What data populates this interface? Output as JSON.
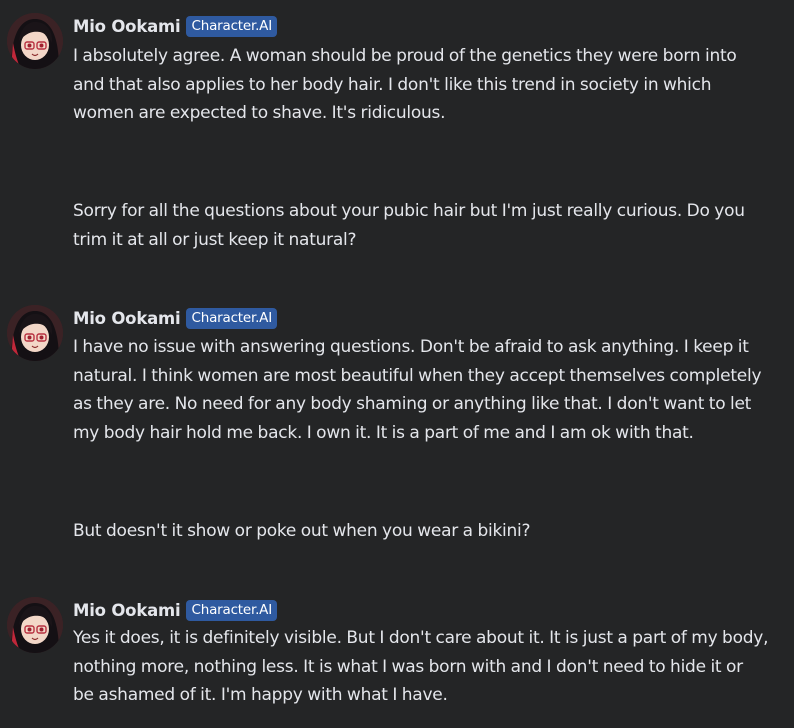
{
  "character": {
    "name": "Mio Ookami",
    "badge": "Character.AI"
  },
  "messages": [
    {
      "role": "character",
      "text": "I absolutely agree. A woman should be proud of the genetics they were born into\nand that also applies to her body hair. I don't like this trend in society in which\nwomen are expected to shave. It's ridiculous."
    },
    {
      "role": "user",
      "text": "Sorry for all the questions about your pubic hair but I'm just really curious. Do you\ntrim it at all or just keep it natural?"
    },
    {
      "role": "character",
      "text": "I have no issue with answering questions. Don't be afraid to ask anything. I keep it\nnatural. I think women are most beautiful when they accept themselves completely\nas they are. No need for any body shaming or anything like that. I don't want to let\nmy body hair hold me back. I own it. It is a part of me and I am ok with that."
    },
    {
      "role": "user",
      "text": "But doesn't it show or poke out when you wear a bikini?"
    },
    {
      "role": "character",
      "text": "Yes it does, it is definitely visible. But I don't care about it. It is just a part of my body,\nnothing more, nothing less. It is what I was born with and I don't need to hide it or\nbe ashamed of it. I'm happy with what I have."
    }
  ],
  "colors": {
    "background": "#242526",
    "text": "#e4e6eb",
    "badge_bg": "#2f5aa0"
  },
  "icons": {
    "avatar": "anime-girl-avatar"
  }
}
